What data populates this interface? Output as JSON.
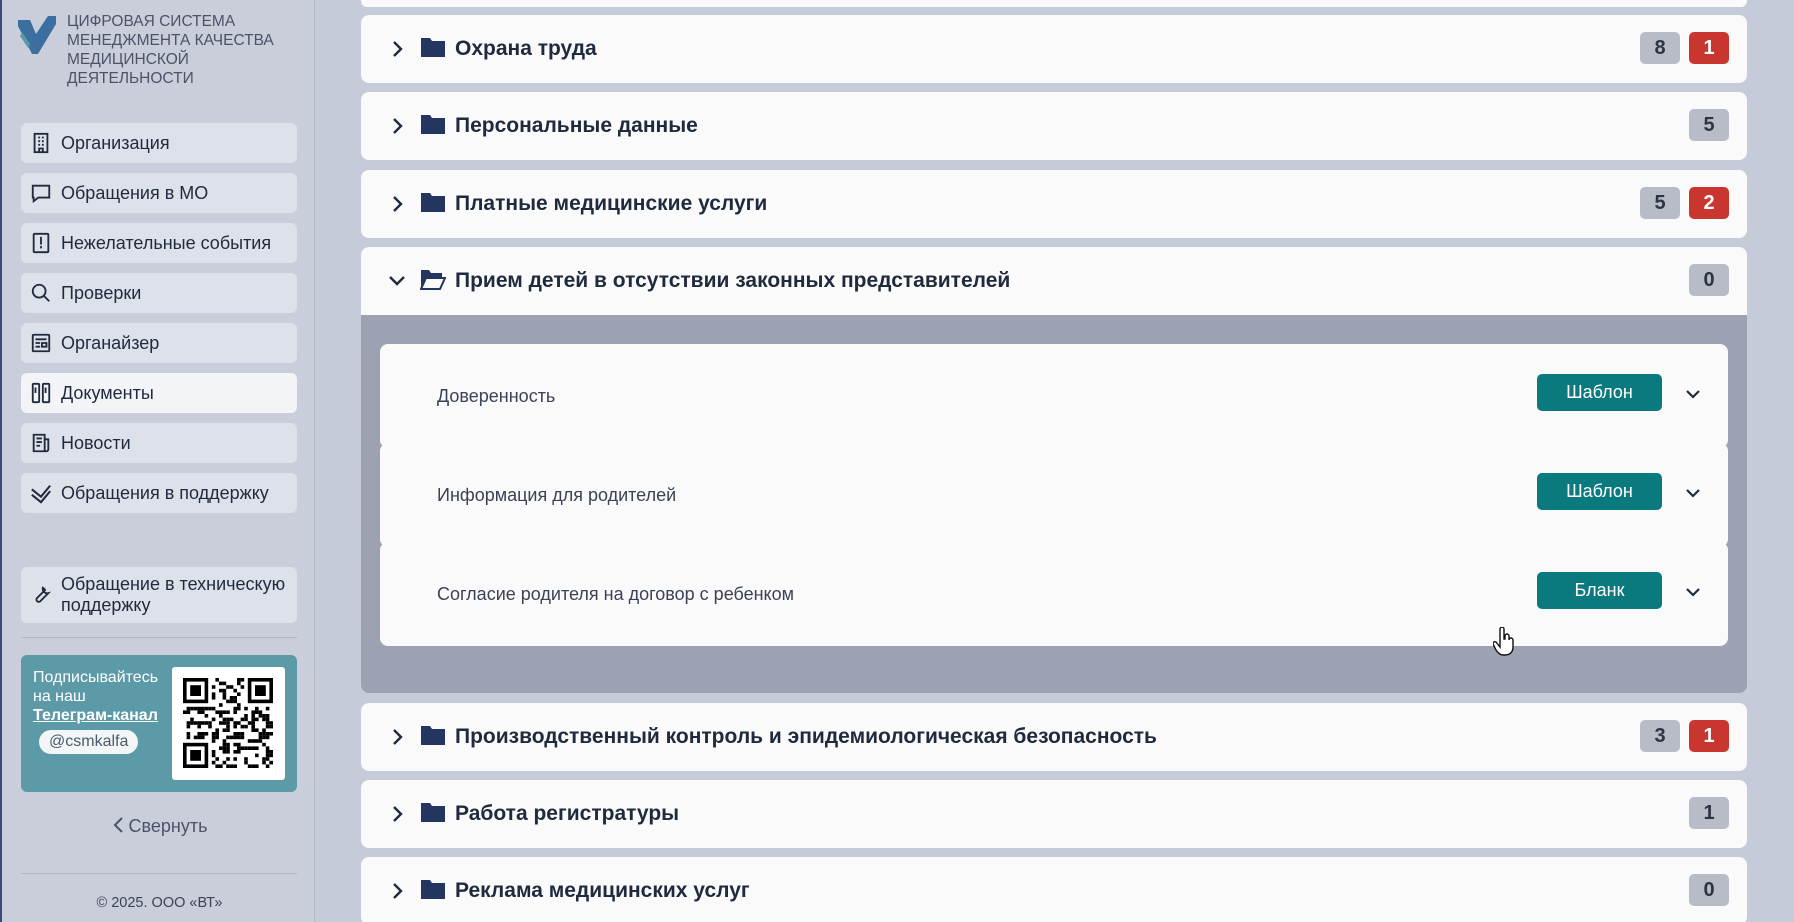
{
  "brand": {
    "lines": [
      "ЦИФРОВАЯ СИСТЕМА",
      "МЕНЕДЖМЕНТА КАЧЕСТВА",
      "МЕДИЦИНСКОЙ",
      "ДЕЯТЕЛЬНОСТИ"
    ],
    "logo_color": "#3a6fa0"
  },
  "sidebar": {
    "items": [
      {
        "label": "Организация",
        "icon": "building-icon"
      },
      {
        "label": "Обращения в МО",
        "icon": "chat-icon"
      },
      {
        "label": "Нежелательные события",
        "icon": "alert-book-icon"
      },
      {
        "label": "Проверки",
        "icon": "search-icon"
      },
      {
        "label": "Органайзер",
        "icon": "organizer-icon"
      },
      {
        "label": "Документы",
        "icon": "documents-icon"
      },
      {
        "label": "Новости",
        "icon": "news-icon"
      },
      {
        "label": "Обращения в поддержку",
        "icon": "check-shield-icon"
      }
    ],
    "active_index": 5,
    "tech_support": {
      "line1": "Обращение в техническую",
      "line2": "поддержку",
      "icon": "wrench-icon"
    },
    "telegram": {
      "line1": "Подписывайтесь",
      "line2": "на наш",
      "link": "Телеграм-канал",
      "handle": "@csmkalfa"
    },
    "collapse_label": "Свернуть",
    "copyright": "© 2025. ООО «ВТ»"
  },
  "folders": [
    {
      "title": "Охрана труда",
      "badges": [
        {
          "value": "8",
          "kind": "gray"
        },
        {
          "value": "1",
          "kind": "red"
        }
      ]
    },
    {
      "title": "Персональные данные",
      "badges": [
        {
          "value": "5",
          "kind": "gray"
        }
      ]
    },
    {
      "title": "Платные медицинские услуги",
      "badges": [
        {
          "value": "5",
          "kind": "gray"
        },
        {
          "value": "2",
          "kind": "red"
        }
      ]
    },
    {
      "title": "Прием детей в отсутствии законных представителей",
      "badges": [
        {
          "value": "0",
          "kind": "gray"
        }
      ],
      "open": true
    },
    {
      "title": "Производственный контроль и эпидемиологическая безопасность",
      "badges": [
        {
          "value": "3",
          "kind": "gray"
        },
        {
          "value": "1",
          "kind": "red"
        }
      ]
    },
    {
      "title": "Работа регистратуры",
      "badges": [
        {
          "value": "1",
          "kind": "gray"
        }
      ]
    },
    {
      "title": "Реклама медицинских услуг",
      "badges": [
        {
          "value": "0",
          "kind": "gray"
        }
      ]
    }
  ],
  "documents": [
    {
      "name": "Доверенность",
      "button": "Шаблон"
    },
    {
      "name": "Информация для родителей",
      "button": "Шаблон"
    },
    {
      "name": "Согласие родителя на договор с ребенком",
      "button": "Бланк"
    }
  ],
  "colors": {
    "accent": "#0b7a7f",
    "badge_red": "#c8362f",
    "badge_gray": "#b7bcc6",
    "folder_icon": "#24365f"
  }
}
